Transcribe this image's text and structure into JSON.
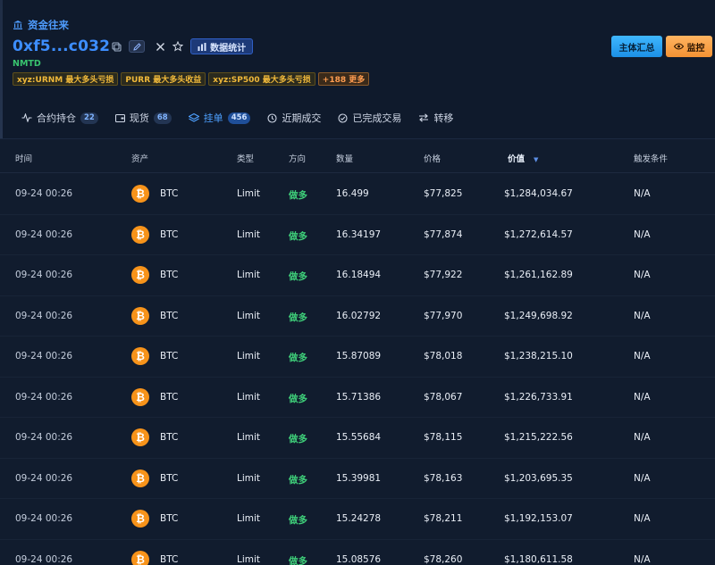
{
  "header": {
    "breadcrumb": "资金往来",
    "address": "0xf5...c032",
    "stats_label": "数据统计",
    "name": "NMTD",
    "tags": [
      "xyz:URNM 最大多头亏损",
      "PURR 最大多头收益",
      "xyz:SP500 最大多头亏损",
      "+188 更多"
    ],
    "summary_button": "主体汇总",
    "monitor_button": "监控"
  },
  "tabs": [
    {
      "label": "合约持仓",
      "count": "22",
      "icon": "pulse-icon",
      "active": false
    },
    {
      "label": "现货",
      "count": "68",
      "icon": "wallet-icon",
      "active": false
    },
    {
      "label": "挂单",
      "count": "456",
      "icon": "layers-icon",
      "active": true
    },
    {
      "label": "近期成交",
      "count": "",
      "icon": "history-icon",
      "active": false
    },
    {
      "label": "已完成交易",
      "count": "",
      "icon": "check-circle-icon",
      "active": false
    },
    {
      "label": "转移",
      "count": "",
      "icon": "transfer-icon",
      "active": false
    }
  ],
  "table": {
    "columns": [
      "时间",
      "资产",
      "类型",
      "方向",
      "数量",
      "价格",
      "价值",
      "触发条件"
    ],
    "sorted_column": "价值",
    "rows": [
      {
        "time": "09-24 00:26",
        "asset": "BTC",
        "type": "Limit",
        "direction": "做多",
        "qty": "16.499",
        "price": "$77,825",
        "value": "$1,284,034.67",
        "trigger": "N/A"
      },
      {
        "time": "09-24 00:26",
        "asset": "BTC",
        "type": "Limit",
        "direction": "做多",
        "qty": "16.34197",
        "price": "$77,874",
        "value": "$1,272,614.57",
        "trigger": "N/A"
      },
      {
        "time": "09-24 00:26",
        "asset": "BTC",
        "type": "Limit",
        "direction": "做多",
        "qty": "16.18494",
        "price": "$77,922",
        "value": "$1,261,162.89",
        "trigger": "N/A"
      },
      {
        "time": "09-24 00:26",
        "asset": "BTC",
        "type": "Limit",
        "direction": "做多",
        "qty": "16.02792",
        "price": "$77,970",
        "value": "$1,249,698.92",
        "trigger": "N/A"
      },
      {
        "time": "09-24 00:26",
        "asset": "BTC",
        "type": "Limit",
        "direction": "做多",
        "qty": "15.87089",
        "price": "$78,018",
        "value": "$1,238,215.10",
        "trigger": "N/A"
      },
      {
        "time": "09-24 00:26",
        "asset": "BTC",
        "type": "Limit",
        "direction": "做多",
        "qty": "15.71386",
        "price": "$78,067",
        "value": "$1,226,733.91",
        "trigger": "N/A"
      },
      {
        "time": "09-24 00:26",
        "asset": "BTC",
        "type": "Limit",
        "direction": "做多",
        "qty": "15.55684",
        "price": "$78,115",
        "value": "$1,215,222.56",
        "trigger": "N/A"
      },
      {
        "time": "09-24 00:26",
        "asset": "BTC",
        "type": "Limit",
        "direction": "做多",
        "qty": "15.39981",
        "price": "$78,163",
        "value": "$1,203,695.35",
        "trigger": "N/A"
      },
      {
        "time": "09-24 00:26",
        "asset": "BTC",
        "type": "Limit",
        "direction": "做多",
        "qty": "15.24278",
        "price": "$78,211",
        "value": "$1,192,153.07",
        "trigger": "N/A"
      },
      {
        "time": "09-24 00:26",
        "asset": "BTC",
        "type": "Limit",
        "direction": "做多",
        "qty": "15.08576",
        "price": "$78,260",
        "value": "$1,180,611.58",
        "trigger": "N/A"
      }
    ]
  },
  "colors": {
    "accent": "#3d8eff",
    "long": "#3fd07a",
    "btc": "#f7931a",
    "tag_text": "#f0b93a"
  }
}
